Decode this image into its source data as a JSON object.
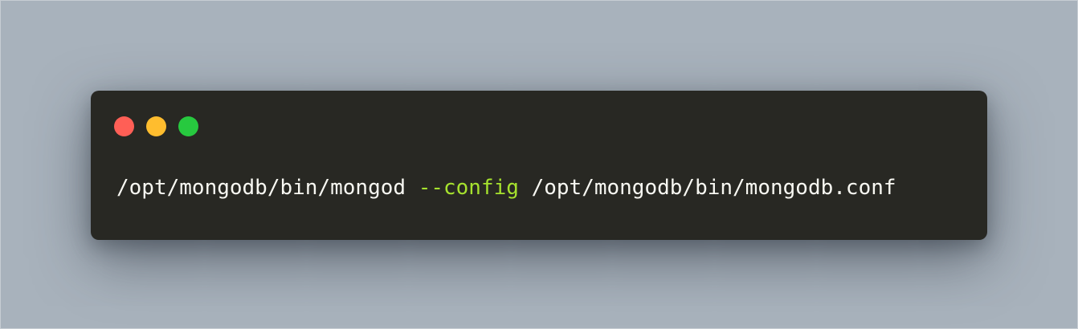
{
  "window": {
    "buttons": {
      "close_color": "#ff5f56",
      "minimize_color": "#ffbd2e",
      "maximize_color": "#27c93f"
    }
  },
  "code": {
    "text_color": "#f8f8f2",
    "flag_color": "#a6e22e",
    "tokens": {
      "command": "/opt/mongodb/bin/mongod",
      "space_1": " ",
      "flag": "--config",
      "space_2": " ",
      "argument": "/opt/mongodb/bin/mongodb.conf"
    }
  }
}
